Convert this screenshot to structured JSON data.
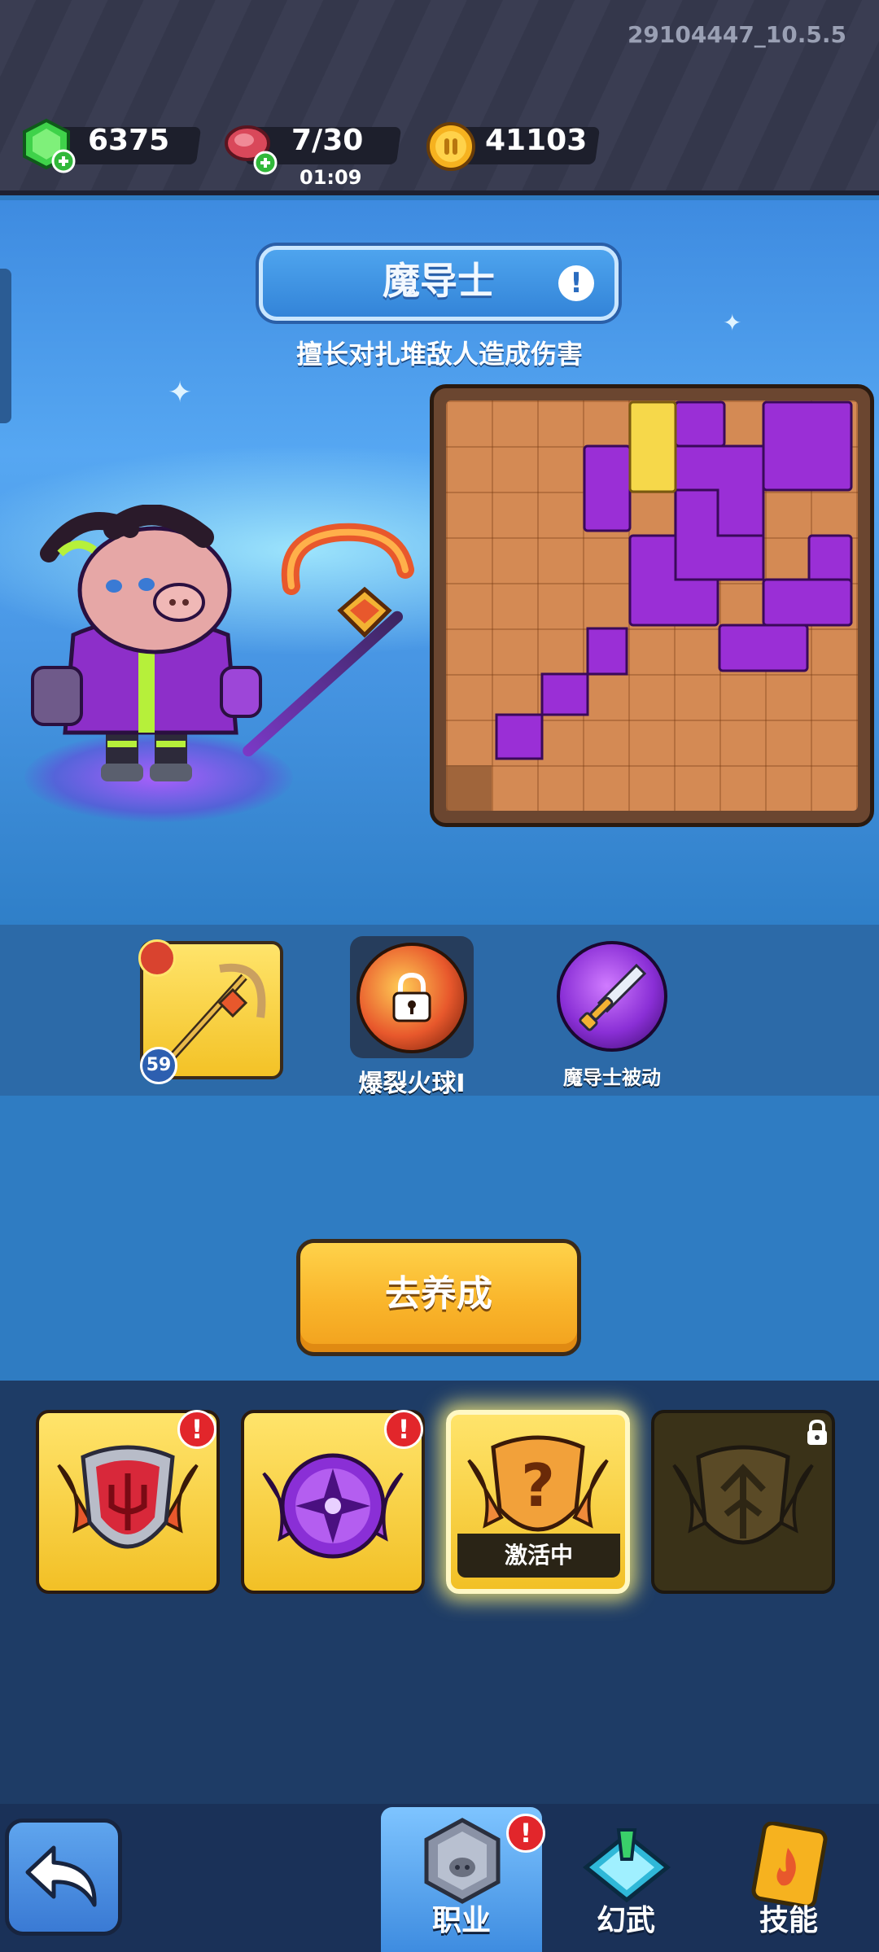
{
  "build_version": "29104447_10.5.5",
  "resources": {
    "gems": "6375",
    "stamina": "7/30",
    "stamina_timer": "01:09",
    "coins": "41103"
  },
  "hero": {
    "class_name": "魔导士",
    "description": "擅长对扎堆敌人造成伤害"
  },
  "equipment": {
    "weapon_level": "59",
    "skill_1_label": "爆裂火球I",
    "skill_2_label": "魔导士被动"
  },
  "cta_label": "去养成",
  "badges": {
    "active_label": "激活中",
    "alert_mark": "!"
  },
  "nav": {
    "tab_1": "职业",
    "tab_2": "幻武",
    "tab_3": "技能",
    "alert_mark": "!"
  },
  "colors": {
    "accent_gold": "#f9b52b",
    "purple_piece": "#9a2fd6",
    "yellow_piece": "#f6d84a",
    "alert_red": "#e2262b"
  }
}
